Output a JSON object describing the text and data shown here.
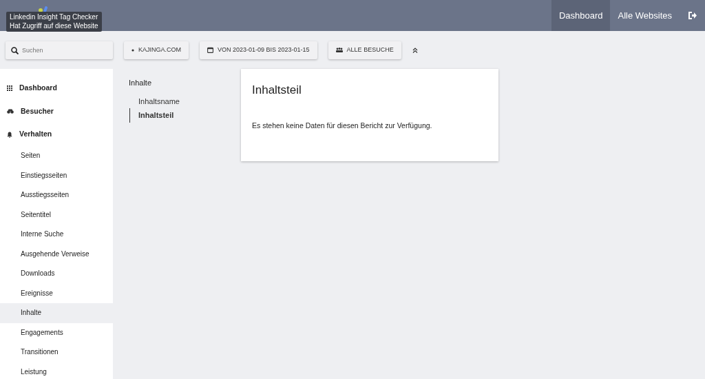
{
  "header": {
    "nav": [
      {
        "label": "Dashboard",
        "selected": true
      },
      {
        "label": "Alle Websites",
        "selected": false
      }
    ],
    "tooltip": [
      "Linkedin Insight Tag Checker",
      "Hat Zugriff auf diese Website"
    ]
  },
  "filters": {
    "search": {
      "placeholder": "Suchen"
    },
    "buttons": [
      {
        "kind": "site",
        "label": "KAJINGA.COM"
      },
      {
        "kind": "date",
        "label": "VON 2023-01-09 BIS 2023-01-15"
      },
      {
        "kind": "segment",
        "label": "ALLE BESUCHE"
      }
    ]
  },
  "sidebar": {
    "items": [
      {
        "label": "Dashboard",
        "kind": "grid",
        "selected": false
      },
      {
        "label": "Besucher",
        "kind": "binoculars",
        "selected": false
      },
      {
        "label": "Verhalten",
        "kind": "bell",
        "selected": false,
        "children": [
          {
            "label": "Seiten",
            "selected": false
          },
          {
            "label": "Einstiegsseiten",
            "selected": false
          },
          {
            "label": "Ausstiegsseiten",
            "selected": false
          },
          {
            "label": "Seitentitel",
            "selected": false
          },
          {
            "label": "Interne Suche",
            "selected": false
          },
          {
            "label": "Ausgehende Verweise",
            "selected": false
          },
          {
            "label": "Downloads",
            "selected": false
          },
          {
            "label": "Ereignisse",
            "selected": false
          },
          {
            "label": "Inhalte",
            "selected": true
          },
          {
            "label": "Engagements",
            "selected": false
          },
          {
            "label": "Transitionen",
            "selected": false
          },
          {
            "label": "Leistung",
            "selected": false
          }
        ]
      }
    ]
  },
  "subnav": {
    "title": "Inhalte",
    "items": [
      {
        "label": "Inhaltsname",
        "selected": false
      },
      {
        "label": "Inhaltsteil",
        "selected": true
      }
    ]
  },
  "report": {
    "title": "Inhaltsteil",
    "message": "Es stehen keine Daten für diesen Bericht zur Verfügung."
  }
}
